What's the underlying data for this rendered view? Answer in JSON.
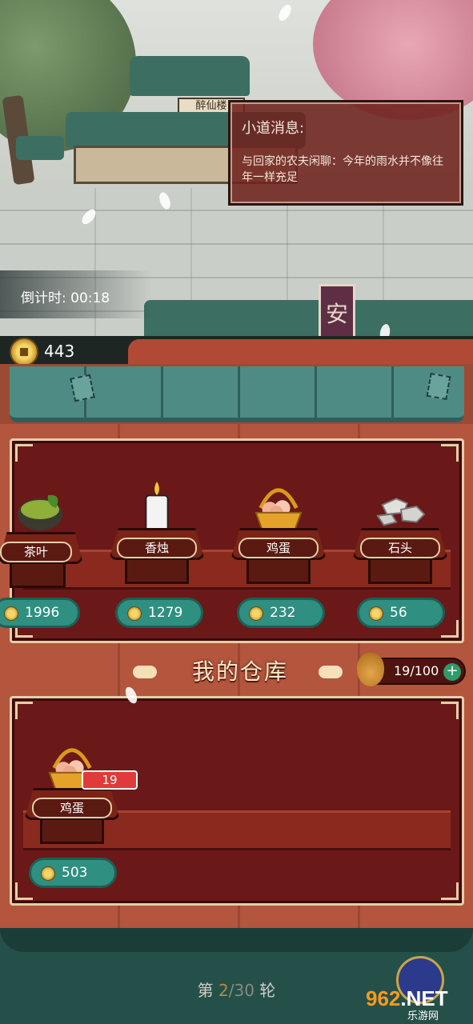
{
  "notice": {
    "title": "小道消息:",
    "body": "与回家的农夫闲聊：今年的雨水并不像往年一样充足"
  },
  "scene": {
    "signboard": "醉仙楼",
    "banner_char": "安"
  },
  "countdown": {
    "text": "倒计时: 00:18"
  },
  "coins": {
    "amount": "443"
  },
  "shop": {
    "items": [
      {
        "name": "茶叶",
        "price": "1996",
        "icon": "tea-icon"
      },
      {
        "name": "香烛",
        "price": "1279",
        "icon": "candle-icon"
      },
      {
        "name": "鸡蛋",
        "price": "232",
        "icon": "egg-basket-icon"
      },
      {
        "name": "石头",
        "price": "56",
        "icon": "stone-icon"
      }
    ]
  },
  "warehouse": {
    "title": "我的仓库",
    "capacity": "19/100",
    "items": [
      {
        "name": "鸡蛋",
        "count": "19",
        "price": "503",
        "icon": "egg-basket-icon"
      }
    ]
  },
  "round": {
    "prefix": "第",
    "current": "2",
    "sep": "/",
    "total": "30",
    "suffix": "轮"
  },
  "watermark": {
    "brand_num": "962",
    "brand_tld": ".NET",
    "brand_cn": "乐游网"
  },
  "colors": {
    "panel": "#6b1818",
    "price_pill": "#2f8f80",
    "badge": "#e03a3a",
    "bottom": "#25504a"
  }
}
